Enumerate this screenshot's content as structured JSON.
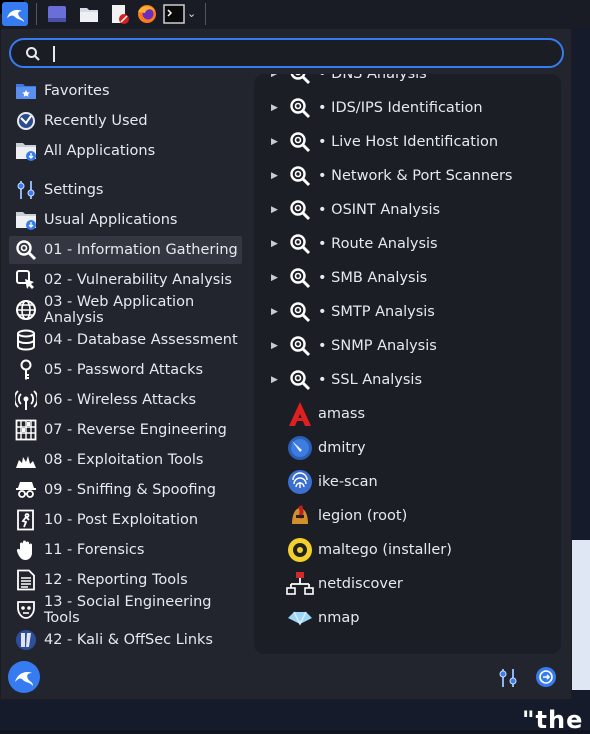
{
  "search": {
    "value": "",
    "placeholder": ""
  },
  "categories": [
    {
      "label": "Favorites",
      "name": "favorites",
      "icon": "star-folder-icon"
    },
    {
      "label": "Recently Used",
      "name": "recently-used",
      "icon": "clock-icon"
    },
    {
      "label": "All Applications",
      "name": "all-applications",
      "icon": "folder-icon"
    },
    {
      "label": "Settings",
      "name": "settings",
      "icon": "settings-sliders-icon"
    },
    {
      "label": "Usual Applications",
      "name": "usual-applications",
      "icon": "folder-icon"
    },
    {
      "label": "01 - Information Gathering",
      "name": "information-gathering",
      "icon": "magnifier-icon",
      "active": true
    },
    {
      "label": "02 - Vulnerability Analysis",
      "name": "vulnerability-analysis",
      "icon": "bug-icon"
    },
    {
      "label": "03 - Web Application Analysis",
      "name": "web-application-analysis",
      "icon": "globe-icon"
    },
    {
      "label": "04 - Database Assessment",
      "name": "database-assessment",
      "icon": "database-icon"
    },
    {
      "label": "05 - Password Attacks",
      "name": "password-attacks",
      "icon": "key-icon"
    },
    {
      "label": "06 - Wireless Attacks",
      "name": "wireless-attacks",
      "icon": "wireless-icon"
    },
    {
      "label": "07 - Reverse Engineering",
      "name": "reverse-engineering",
      "icon": "grid-icon"
    },
    {
      "label": "08 - Exploitation Tools",
      "name": "exploitation-tools",
      "icon": "explosion-icon"
    },
    {
      "label": "09 - Sniffing & Spoofing",
      "name": "sniffing-spoofing",
      "icon": "spy-icon"
    },
    {
      "label": "10 - Post Exploitation",
      "name": "post-exploitation",
      "icon": "door-icon"
    },
    {
      "label": "11 - Forensics",
      "name": "forensics",
      "icon": "hand-icon"
    },
    {
      "label": "12 - Reporting Tools",
      "name": "reporting-tools",
      "icon": "document-icon"
    },
    {
      "label": "13 - Social Engineering Tools",
      "name": "social-engineering-tools",
      "icon": "mask-icon"
    },
    {
      "label": "42 - Kali & OffSec Links",
      "name": "kali-offsec-links",
      "icon": "kali-icon"
    }
  ],
  "apps": [
    {
      "label": "• DNS Analysis",
      "name": "dns-analysis",
      "submenu": true,
      "icon": "magnifier-icon"
    },
    {
      "label": "• IDS/IPS Identification",
      "name": "ids-ips-identification",
      "submenu": true,
      "icon": "magnifier-icon"
    },
    {
      "label": "• Live Host Identification",
      "name": "live-host-identification",
      "submenu": true,
      "icon": "magnifier-icon"
    },
    {
      "label": "• Network & Port Scanners",
      "name": "network-port-scanners",
      "submenu": true,
      "icon": "magnifier-icon"
    },
    {
      "label": "• OSINT Analysis",
      "name": "osint-analysis",
      "submenu": true,
      "icon": "magnifier-icon"
    },
    {
      "label": "• Route Analysis",
      "name": "route-analysis",
      "submenu": true,
      "icon": "magnifier-icon"
    },
    {
      "label": "• SMB Analysis",
      "name": "smb-analysis",
      "submenu": true,
      "icon": "magnifier-icon"
    },
    {
      "label": "• SMTP Analysis",
      "name": "smtp-analysis",
      "submenu": true,
      "icon": "magnifier-icon"
    },
    {
      "label": "• SNMP Analysis",
      "name": "snmp-analysis",
      "submenu": true,
      "icon": "magnifier-icon"
    },
    {
      "label": "• SSL Analysis",
      "name": "ssl-analysis",
      "submenu": true,
      "icon": "magnifier-icon"
    },
    {
      "label": "amass",
      "name": "amass",
      "submenu": false,
      "icon": "amass-icon"
    },
    {
      "label": "dmitry",
      "name": "dmitry",
      "submenu": false,
      "icon": "dmitry-icon"
    },
    {
      "label": "ike-scan",
      "name": "ike-scan",
      "submenu": false,
      "icon": "fingerprint-icon"
    },
    {
      "label": "legion (root)",
      "name": "legion-root",
      "submenu": false,
      "icon": "helmet-icon"
    },
    {
      "label": "maltego (installer)",
      "name": "maltego-installer",
      "submenu": false,
      "icon": "maltego-icon"
    },
    {
      "label": "netdiscover",
      "name": "netdiscover",
      "submenu": false,
      "icon": "network-icon"
    },
    {
      "label": "nmap",
      "name": "nmap",
      "submenu": false,
      "icon": "eye-icon"
    }
  ],
  "desktop": {
    "wallpaper_text": "\"the"
  },
  "colors": {
    "accent": "#367bf0",
    "menu_bg": "#23252e",
    "list_bg": "#1c1e26",
    "active_bg": "#343741"
  }
}
